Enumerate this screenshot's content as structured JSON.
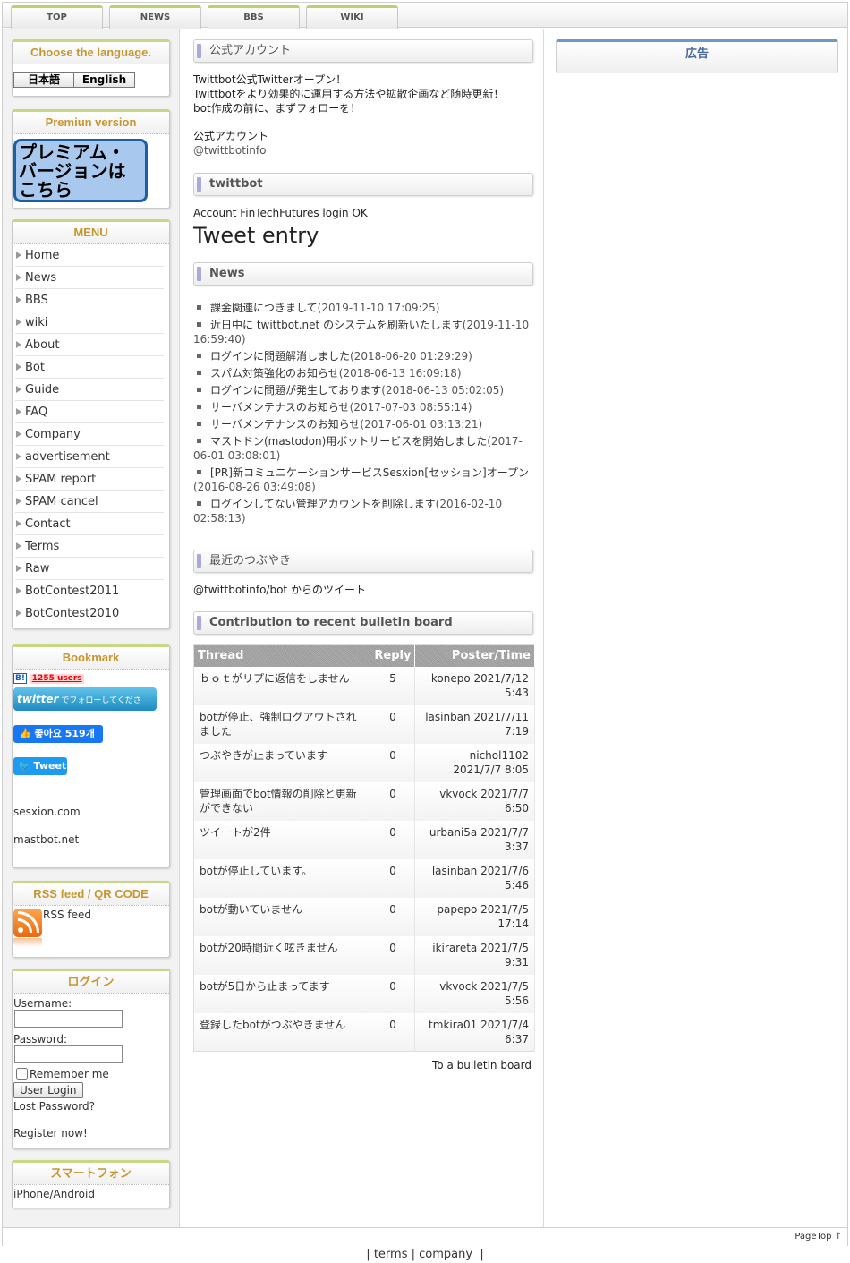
{
  "tabs": [
    "TOP",
    "NEWS",
    "BBS",
    "WIKI"
  ],
  "sidebar": {
    "language": {
      "title": "Choose the language.",
      "japanese": "日本語",
      "english": "English"
    },
    "premium": {
      "title": "Premiun version",
      "button": "プレミアム・バージョンはこちら"
    },
    "menu": {
      "title": "MENU",
      "items": [
        "Home",
        "News",
        "BBS",
        "wiki",
        "About",
        "Bot",
        "Guide",
        "FAQ",
        "Company",
        "advertisement",
        "SPAM report",
        "SPAM cancel",
        "Contact",
        "Terms",
        "Raw",
        "BotContest2011",
        "BotContest2010"
      ]
    },
    "bookmark": {
      "title": "Bookmark",
      "hatena_badge": "B!",
      "hatena_users": "1255 users",
      "twitter_follow": "でフォローしてください！",
      "twitter_logo": "twitter",
      "fb_like": "좋아요 519개",
      "tweet": "Tweet",
      "links": [
        "sesxion.com",
        "mastbot.net"
      ]
    },
    "rss": {
      "title": "RSS feed / QR CODE",
      "label": "RSS feed"
    },
    "login": {
      "title": "ログイン",
      "username_label": "Username:",
      "password_label": "Password:",
      "remember": "Remember me",
      "button": "User Login",
      "lost": "Lost Password?",
      "register": "Register now!"
    },
    "smartphone": {
      "title": "スマートフォン",
      "label": "iPhone/Android"
    }
  },
  "main": {
    "official": {
      "heading": "公式アカウント",
      "line1": "Twittbot公式Twitterオープン！",
      "line2": "Twittbotをより効果的に運用する方法や拡散企画など随時更新！",
      "line3": "bot作成の前に、まずフォローを！",
      "label": "公式アカウント",
      "handle": "@twittbotinfo"
    },
    "twittbot": {
      "heading": "twittbot",
      "account": "Account FinTechFutures login OK",
      "entry_title": "Tweet entry"
    },
    "news": {
      "heading": "News",
      "items": [
        {
          "title": "課金関連につきまして",
          "date": "(2019-11-10 17:09:25)"
        },
        {
          "title": "近日中に twittbot.net のシステムを刷新いたします",
          "date": "(2019-11-10 16:59:40)"
        },
        {
          "title": "ログインに問題解消しました",
          "date": "(2018-06-20 01:29:29)"
        },
        {
          "title": "スパム対策強化のお知らせ",
          "date": "(2018-06-13 16:09:18)"
        },
        {
          "title": "ログインに問題が発生しております",
          "date": "(2018-06-13 05:02:05)"
        },
        {
          "title": "サーバメンテナスのお知らせ",
          "date": "(2017-07-03 08:55:14)"
        },
        {
          "title": "サーバメンテナンスのお知らせ",
          "date": "(2017-06-01 03:13:21)"
        },
        {
          "title": "マストドン(mastodon)用ボットサービスを開始しました",
          "date": "(2017-06-01 03:08:01)"
        },
        {
          "title": "[PR]新コミュニケーションサービスSesxion[セッション]オープン",
          "date": "(2016-08-26 03:49:08)"
        },
        {
          "title": "ログインしてない管理アカウントを削除します",
          "date": "(2016-02-10 02:58:13)"
        }
      ]
    },
    "recent": {
      "heading": "最近のつぶやき",
      "text": "@twittbotinfo/bot からのツイート"
    },
    "bbs": {
      "heading": "Contribution to recent bulletin board",
      "columns": [
        "Thread",
        "Reply",
        "Poster/Time"
      ],
      "rows": [
        {
          "thread": "ｂｏｔがリプに返信をしません",
          "reply": "5",
          "poster": "konepo 2021/7/12 5:43"
        },
        {
          "thread": "botが停止、強制ログアウトされました",
          "reply": "0",
          "poster": "lasinban 2021/7/11 7:19"
        },
        {
          "thread": "つぶやきが止まっています",
          "reply": "0",
          "poster": "nichol1102 2021/7/7 8:05"
        },
        {
          "thread": "管理画面でbot情報の削除と更新ができない",
          "reply": "0",
          "poster": "vkvock 2021/7/7 6:50"
        },
        {
          "thread": "ツイートが2件",
          "reply": "0",
          "poster": "urbani5a 2021/7/7 3:37"
        },
        {
          "thread": "botが停止しています。",
          "reply": "0",
          "poster": "lasinban 2021/7/6 5:46"
        },
        {
          "thread": "botが動いていません",
          "reply": "0",
          "poster": "papepo 2021/7/5 17:14"
        },
        {
          "thread": "botが20時間近く呟きません",
          "reply": "0",
          "poster": "ikirareta 2021/7/5 9:31"
        },
        {
          "thread": "botが5日から止まってます",
          "reply": "0",
          "poster": "vkvock 2021/7/5 5:56"
        },
        {
          "thread": "登録したbotがつぶやきません",
          "reply": "0",
          "poster": "tmkira01 2021/7/4 6:37"
        }
      ],
      "link": "To a bulletin board"
    }
  },
  "right": {
    "ad_title": "広告"
  },
  "footer": {
    "pagetop": "PageTop ↑",
    "terms": "terms",
    "company": "company"
  }
}
